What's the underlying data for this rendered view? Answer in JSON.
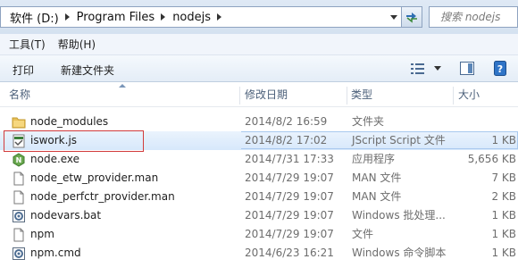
{
  "address": {
    "crumbs": [
      "软件 (D:)",
      "Program Files",
      "nodejs"
    ]
  },
  "search": {
    "placeholder": "搜索 nodejs"
  },
  "menu": {
    "items": [
      "工具(T)",
      "帮助(H)"
    ]
  },
  "toolbar": {
    "print_label": "打印",
    "new_folder_label": "新建文件夹"
  },
  "columns": {
    "name": "名称",
    "date": "修改日期",
    "type": "类型",
    "size": "大小"
  },
  "files": [
    {
      "name": "node_modules",
      "date": "2014/8/2 16:59",
      "type": "文件夹",
      "size": "",
      "icon": "folder-icon"
    },
    {
      "name": "iswork.js",
      "date": "2014/8/2 17:02",
      "type": "JScript Script 文件",
      "size": "1 KB",
      "icon": "jscript-file-icon",
      "selected": true
    },
    {
      "name": "node.exe",
      "date": "2014/7/31 17:33",
      "type": "应用程序",
      "size": "5,656 KB",
      "icon": "nodejs-exe-icon"
    },
    {
      "name": "node_etw_provider.man",
      "date": "2014/7/29 19:07",
      "type": "MAN 文件",
      "size": "7 KB",
      "icon": "file-icon"
    },
    {
      "name": "node_perfctr_provider.man",
      "date": "2014/7/29 19:07",
      "type": "MAN 文件",
      "size": "2 KB",
      "icon": "file-icon"
    },
    {
      "name": "nodevars.bat",
      "date": "2014/7/29 19:07",
      "type": "Windows 批处理...",
      "size": "1 KB",
      "icon": "batch-file-icon"
    },
    {
      "name": "npm",
      "date": "2014/7/29 19:07",
      "type": "文件",
      "size": "1 KB",
      "icon": "file-icon"
    },
    {
      "name": "npm.cmd",
      "date": "2014/6/23 16:21",
      "type": "Windows 命令脚本",
      "size": "1 KB",
      "icon": "batch-file-icon"
    }
  ]
}
